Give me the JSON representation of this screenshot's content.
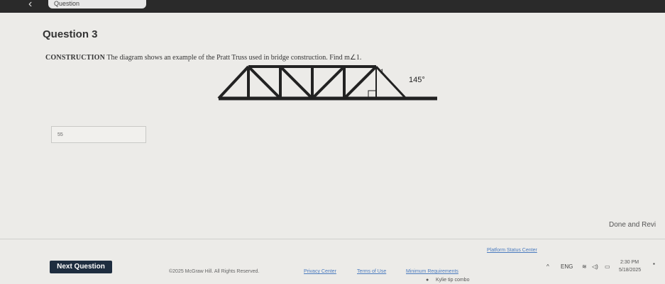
{
  "topbar": {
    "tab_label": "Question"
  },
  "question": {
    "heading": "Question 3",
    "prompt_keyword": "CONSTRUCTION",
    "prompt_text": " The diagram shows an example of the Pratt Truss used in bridge construction. Find m∠1.",
    "angle_label": "1",
    "angle_value": "145°",
    "answer_value": "55"
  },
  "actions": {
    "done_label": "Done and Revi",
    "next_label": "Next Question"
  },
  "footer": {
    "copyright": "©2025 McGraw Hill. All Rights Reserved.",
    "links": [
      "Privacy Center",
      "Terms of Use",
      "Minimum Requirements",
      "Platform Status Center"
    ]
  },
  "taskbar": {
    "lang": "ENG",
    "time": "2:30 PM",
    "date": "5/18/2025",
    "app_label": "Kylie tip combo"
  },
  "colors": {
    "next_button": "#1e2d3f",
    "link": "#4a7bbf",
    "background": "#ecebe8"
  }
}
